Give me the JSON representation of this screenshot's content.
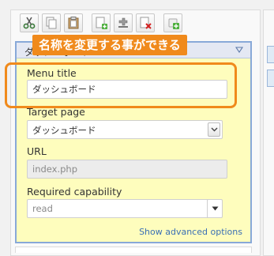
{
  "toolbar": {
    "buttons": [
      {
        "name": "cut-icon"
      },
      {
        "name": "copy-icon"
      },
      {
        "name": "paste-icon"
      },
      {
        "name": "new-menu-icon"
      },
      {
        "name": "new-separator-icon"
      },
      {
        "name": "delete-icon"
      },
      {
        "name": "new-item-icon"
      }
    ]
  },
  "editor": {
    "header_title": "ダッシュボード",
    "fields": {
      "menu_title": {
        "label": "Menu title",
        "value": "ダッシュボード"
      },
      "target_page": {
        "label": "Target page",
        "value": "ダッシュボード"
      },
      "url": {
        "label": "URL",
        "value": "index.php"
      },
      "capability": {
        "label": "Required capability",
        "value": "read"
      }
    },
    "advanced_link": "Show advanced options"
  },
  "annotation": {
    "callout_text": "名称を変更する事ができる"
  },
  "colors": {
    "accent_orange": "#f08a1c",
    "editor_bg": "#fefdbd",
    "editor_border": "#88a9d8",
    "link": "#3a6fb5"
  }
}
